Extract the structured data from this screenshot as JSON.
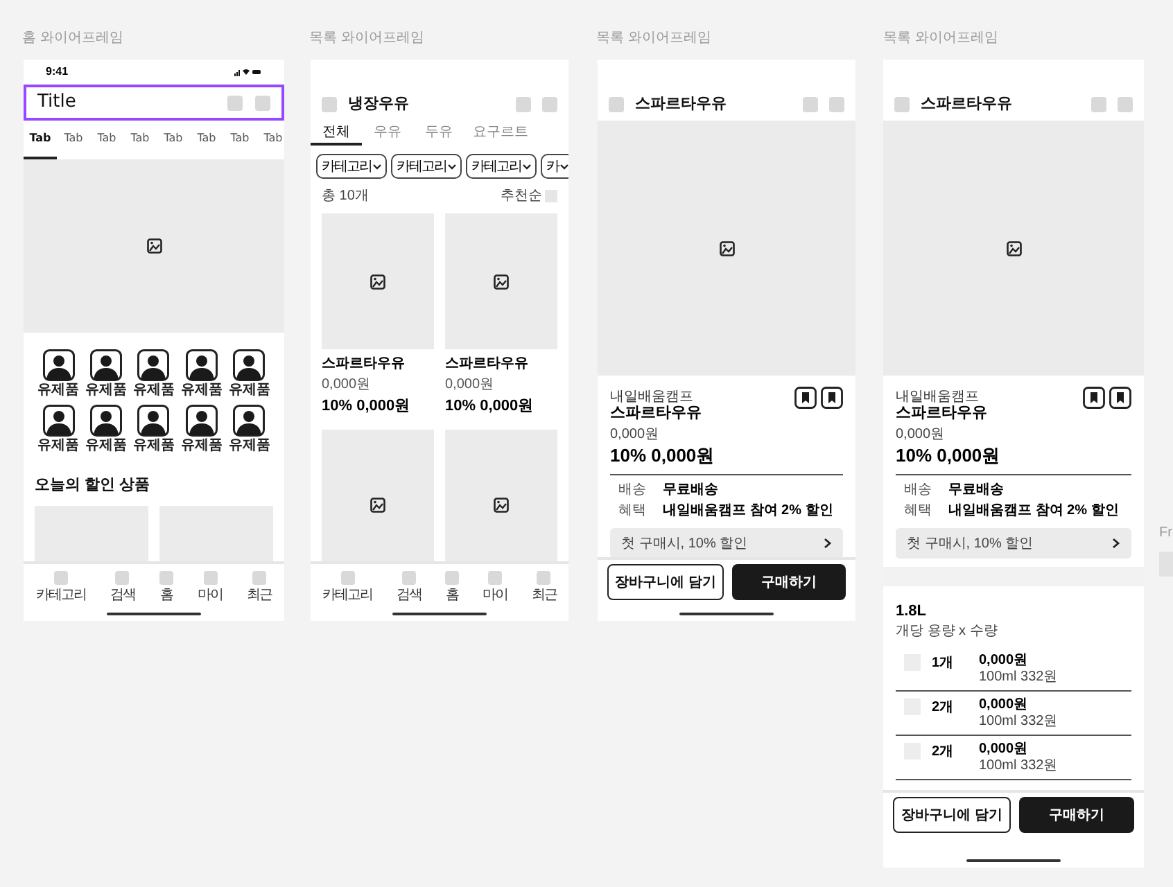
{
  "frames": [
    {
      "kind": "home",
      "label": "홈 와이어프레임",
      "status_time": "9:41",
      "title": "Title",
      "title_selected": true,
      "tabs": [
        {
          "label": "Tab",
          "selected": true
        },
        {
          "label": "Tab",
          "selected": false
        },
        {
          "label": "Tab",
          "selected": false
        },
        {
          "label": "Tab",
          "selected": false
        },
        {
          "label": "Tab",
          "selected": false
        },
        {
          "label": "Tab",
          "selected": false
        },
        {
          "label": "Tab",
          "selected": false
        },
        {
          "label": "Tab",
          "selected": false
        }
      ],
      "categories": [
        "유제품",
        "유제품",
        "유제품",
        "유제품",
        "유제품",
        "유제품",
        "유제품",
        "유제품",
        "유제품",
        "유제품"
      ],
      "section_title": "오늘의 할인 상품",
      "nav": [
        "카테고리",
        "검색",
        "홈",
        "마이",
        "최근"
      ]
    },
    {
      "kind": "list",
      "label": "목록 와이어프레임",
      "title": "냉장우유",
      "tabs": [
        {
          "label": "전체",
          "selected": true
        },
        {
          "label": "우유",
          "selected": false
        },
        {
          "label": "두유",
          "selected": false
        },
        {
          "label": "요구르트",
          "selected": false
        }
      ],
      "filters": [
        "카테고리",
        "카테고리",
        "카테고리",
        "카"
      ],
      "count": "총 10개",
      "sort": "추천순",
      "products": [
        {
          "name": "스파르타우유",
          "price": "0,000원",
          "sale": "10% 0,000원"
        },
        {
          "name": "스파르타우유",
          "price": "0,000원",
          "sale": "10% 0,000원"
        }
      ],
      "nav": [
        "카테고리",
        "검색",
        "홈",
        "마이",
        "최근"
      ]
    },
    {
      "kind": "detail",
      "label": "목록 와이어프레임",
      "title": "스파르타우유",
      "brand": "내일배움캠프",
      "name": "스파르타우유",
      "price": "0,000원",
      "sale": "10% 0,000원",
      "info": [
        {
          "label": "배송",
          "value": "무료배송"
        },
        {
          "label": "혜택",
          "value": "내일배움캠프 참여 2% 할인"
        }
      ],
      "coupon": "첫 구매시, 10% 할인",
      "buttons": [
        "장바구니에 담기",
        "구매하기"
      ]
    },
    {
      "kind": "options",
      "label": "목록 와이어프레임",
      "title": "스파르타우유",
      "brand": "내일배움캠프",
      "name": "스파르타우유",
      "price": "0,000원",
      "sale": "10% 0,000원",
      "info": [
        {
          "label": "배송",
          "value": "무료배송"
        },
        {
          "label": "혜택",
          "value": "내일배움캠프 참여 2% 할인"
        }
      ],
      "coupon": "첫 구매시, 10% 할인",
      "volume": "1.8L",
      "volume_hint": "개당 용량 x 수량",
      "options": [
        {
          "qty": "1개",
          "price": "0,000원",
          "unit": "100ml 332원",
          "checked": false
        },
        {
          "qty": "2개",
          "price": "0,000원",
          "unit": "100ml 332원",
          "checked": false
        },
        {
          "qty": "2개",
          "price": "0,000원",
          "unit": "100ml 332원",
          "checked": false
        }
      ],
      "buttons": [
        "장바구니에 담기",
        "구매하기"
      ]
    }
  ],
  "next_frame_label": "Fr"
}
